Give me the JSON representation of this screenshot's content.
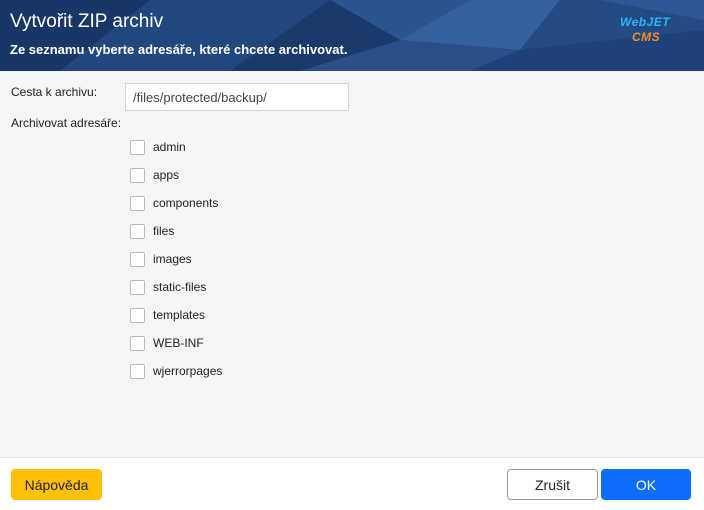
{
  "header": {
    "title": "Vytvořit ZIP archiv",
    "subtitle": "Ze seznamu vyberte adresáře, které chcete archivovat.",
    "logo": {
      "top": "WebJET",
      "bottom": "CMS",
      "colors": {
        "top": "#29b6f6",
        "bottom": "#f28c28"
      }
    }
  },
  "form": {
    "path_label": "Cesta k archivu:",
    "path_value": "/files/protected/backup/",
    "dirs_label": "Archivovat adresáře:",
    "directories": [
      {
        "name": "admin",
        "checked": false
      },
      {
        "name": "apps",
        "checked": false
      },
      {
        "name": "components",
        "checked": false
      },
      {
        "name": "files",
        "checked": false
      },
      {
        "name": "images",
        "checked": false
      },
      {
        "name": "static-files",
        "checked": false
      },
      {
        "name": "templates",
        "checked": false
      },
      {
        "name": "WEB-INF",
        "checked": false
      },
      {
        "name": "wjerrorpages",
        "checked": false
      }
    ]
  },
  "footer": {
    "help_label": "Nápověda",
    "cancel_label": "Zrušit",
    "ok_label": "OK"
  },
  "colors": {
    "header_bg": "#1c3d73",
    "help": "#ffc107",
    "ok": "#0d6efd"
  }
}
